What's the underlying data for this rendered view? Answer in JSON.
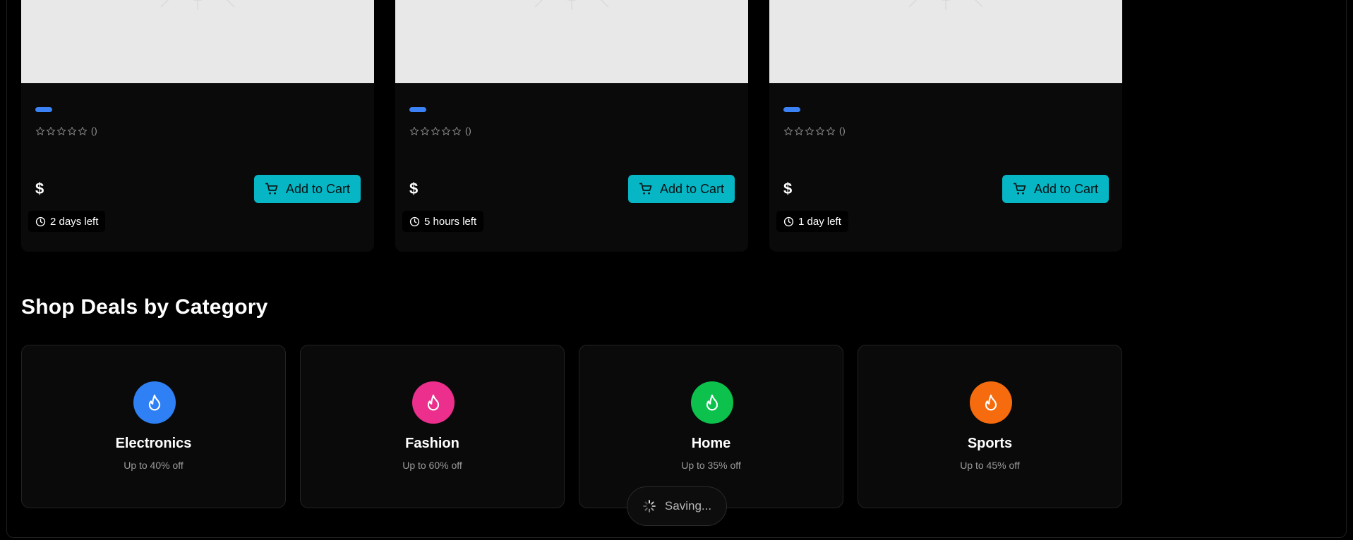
{
  "products": [
    {
      "price": "$",
      "rating_count": "()",
      "cart_label": "Add to Cart",
      "time_left": "2 days left"
    },
    {
      "price": "$",
      "rating_count": "()",
      "cart_label": "Add to Cart",
      "time_left": "5 hours left"
    },
    {
      "price": "$",
      "rating_count": "()",
      "cart_label": "Add to Cart",
      "time_left": "1 day left"
    }
  ],
  "categories_section": {
    "title": "Shop Deals by Category",
    "items": [
      {
        "name": "Electronics",
        "discount": "Up to 40% off",
        "color": "#2f80f5",
        "icon": "flame-icon"
      },
      {
        "name": "Fashion",
        "discount": "Up to 60% off",
        "color": "#ec2e8c",
        "icon": "flame-icon"
      },
      {
        "name": "Home",
        "discount": "Up to 35% off",
        "color": "#0cc14c",
        "icon": "flame-icon"
      },
      {
        "name": "Sports",
        "discount": "Up to 45% off",
        "color": "#f56b0e",
        "icon": "flame-icon"
      }
    ]
  },
  "toast": {
    "label": "Saving...",
    "icon": "spinner-icon"
  },
  "colors": {
    "accent": "#06b6c4",
    "category_pill": "#3b82f6",
    "background": "#000000",
    "card": "#0a0a0a"
  }
}
